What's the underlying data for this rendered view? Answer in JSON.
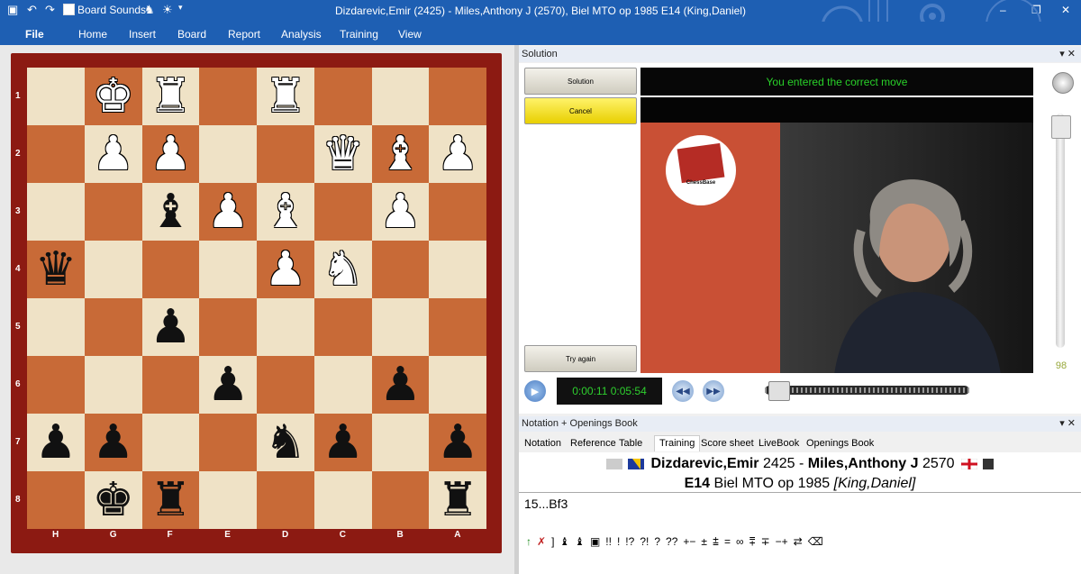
{
  "titlebar": {
    "title": "Dizdarevic,Emir (2425) - Miles,Anthony J (2570), Biel MTO op 1985  E14  (King,Daniel)",
    "board_sounds": "Board Sounds",
    "min": "–",
    "restore": "❐",
    "close": "✕"
  },
  "ribbon": {
    "file": "File",
    "home": "Home",
    "insert": "Insert",
    "board": "Board",
    "report": "Report",
    "analysis": "Analysis",
    "training": "Training",
    "view": "View"
  },
  "board": {
    "ranks": [
      "1",
      "2",
      "3",
      "4",
      "5",
      "6",
      "7",
      "8"
    ],
    "files": [
      "H",
      "G",
      "F",
      "E",
      "D",
      "C",
      "B",
      "A"
    ],
    "rows": [
      [
        "",
        "wK",
        "wR",
        "",
        "wR",
        "",
        "",
        ""
      ],
      [
        "",
        "wP",
        "wP",
        "",
        "",
        "wQ",
        "wB",
        "wP"
      ],
      [
        "",
        "",
        "bB",
        "wP",
        "wB",
        "",
        "wP",
        ""
      ],
      [
        "bQ",
        "",
        "",
        "",
        "wP",
        "wN",
        "",
        ""
      ],
      [
        "",
        "",
        "bP",
        "",
        "",
        "",
        "",
        ""
      ],
      [
        "",
        "",
        "",
        "bP",
        "",
        "",
        "bP",
        ""
      ],
      [
        "bP",
        "bP",
        "",
        "",
        "bN",
        "bP",
        "",
        "bP"
      ],
      [
        "",
        "bK",
        "bR",
        "",
        "",
        "",
        "",
        "bR"
      ]
    ]
  },
  "solution": {
    "header": "Solution",
    "header_controls": "▾ ✕",
    "btn_solution": "Solution",
    "btn_cancel": "Cancel",
    "btn_try_again": "Try again",
    "message": "You entered the correct move",
    "logo_text": "ChessBase",
    "volume": "98",
    "time": "0:00:11 0:05:54",
    "play_icon": "▶",
    "rewind_icon": "◀◀",
    "forward_icon": "▶▶"
  },
  "notation": {
    "header": "Notation + Openings Book",
    "header_controls": "▾ ✕",
    "tabs": [
      "Notation",
      "Reference",
      "Table",
      "Training",
      "Score sheet",
      "LiveBook",
      "Openings Book"
    ],
    "active_tab": "Training",
    "white_player": "Dizdarevic,Emir",
    "white_elo": "2425",
    "separator": "-",
    "black_player": "Miles,Anthony J",
    "black_elo": "2570",
    "eco": "E14",
    "event": "Biel MTO op 1985",
    "annotator": "[King,Daniel]",
    "move": "15...Bf3",
    "symbols": [
      "↑",
      "✗",
      "]",
      "♝",
      "♝",
      "▣",
      "!!",
      "!",
      "!?",
      "?!",
      "?",
      "??",
      "+−",
      "±",
      "⩲",
      "=",
      "∞",
      "⩱",
      "∓",
      "−+",
      "⇄",
      "⌫"
    ]
  }
}
